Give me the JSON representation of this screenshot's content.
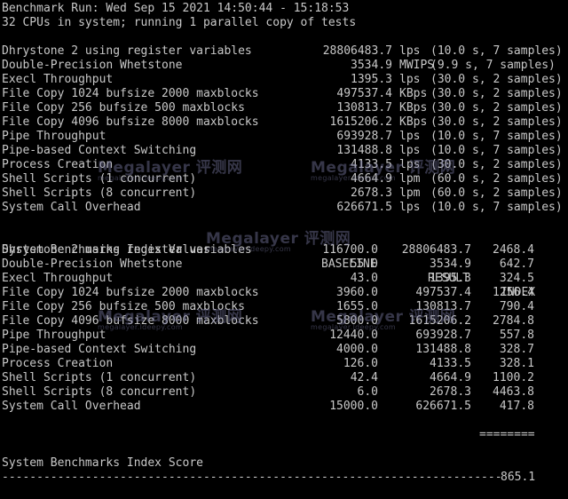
{
  "header": {
    "run_line": "Benchmark Run: Wed Sep 15 2021 14:50:44 - 15:18:53",
    "cpu_line": "32 CPUs in system; running 1 parallel copy of tests"
  },
  "results": [
    {
      "name": "Dhrystone 2 using register variables",
      "value": "28806483.7",
      "unit": "lps",
      "detail": "(10.0 s, 7 samples)"
    },
    {
      "name": "Double-Precision Whetstone",
      "value": "3534.9",
      "unit": "MWIPS",
      "detail": "(9.9 s, 7 samples)"
    },
    {
      "name": "Execl Throughput",
      "value": "1395.3",
      "unit": "lps",
      "detail": "(30.0 s, 2 samples)"
    },
    {
      "name": "File Copy 1024 bufsize 2000 maxblocks",
      "value": "497537.4",
      "unit": "KBps",
      "detail": "(30.0 s, 2 samples)"
    },
    {
      "name": "File Copy 256 bufsize 500 maxblocks",
      "value": "130813.7",
      "unit": "KBps",
      "detail": "(30.0 s, 2 samples)"
    },
    {
      "name": "File Copy 4096 bufsize 8000 maxblocks",
      "value": "1615206.2",
      "unit": "KBps",
      "detail": "(30.0 s, 2 samples)"
    },
    {
      "name": "Pipe Throughput",
      "value": "693928.7",
      "unit": "lps",
      "detail": "(10.0 s, 7 samples)"
    },
    {
      "name": "Pipe-based Context Switching",
      "value": "131488.8",
      "unit": "lps",
      "detail": "(10.0 s, 7 samples)"
    },
    {
      "name": "Process Creation",
      "value": "4133.5",
      "unit": "lps",
      "detail": "(30.0 s, 2 samples)"
    },
    {
      "name": "Shell Scripts (1 concurrent)",
      "value": "4664.9",
      "unit": "lpm",
      "detail": "(60.0 s, 2 samples)"
    },
    {
      "name": "Shell Scripts (8 concurrent)",
      "value": "2678.3",
      "unit": "lpm",
      "detail": "(60.0 s, 2 samples)"
    },
    {
      "name": "System Call Overhead",
      "value": "626671.5",
      "unit": "lps",
      "detail": "(10.0 s, 7 samples)"
    }
  ],
  "index_table": {
    "title": "System Benchmarks Index Values",
    "col_baseline": "BASELINE",
    "col_result": "RESULT",
    "col_index": "INDEX",
    "rows": [
      {
        "name": "Dhrystone 2 using register variables",
        "baseline": "116700.0",
        "result": "28806483.7",
        "index": "2468.4"
      },
      {
        "name": "Double-Precision Whetstone",
        "baseline": "55.0",
        "result": "3534.9",
        "index": "642.7"
      },
      {
        "name": "Execl Throughput",
        "baseline": "43.0",
        "result": "1395.3",
        "index": "324.5"
      },
      {
        "name": "File Copy 1024 bufsize 2000 maxblocks",
        "baseline": "3960.0",
        "result": "497537.4",
        "index": "1256.4"
      },
      {
        "name": "File Copy 256 bufsize 500 maxblocks",
        "baseline": "1655.0",
        "result": "130813.7",
        "index": "790.4"
      },
      {
        "name": "File Copy 4096 bufsize 8000 maxblocks",
        "baseline": "5800.0",
        "result": "1615206.2",
        "index": "2784.8"
      },
      {
        "name": "Pipe Throughput",
        "baseline": "12440.0",
        "result": "693928.7",
        "index": "557.8"
      },
      {
        "name": "Pipe-based Context Switching",
        "baseline": "4000.0",
        "result": "131488.8",
        "index": "328.7"
      },
      {
        "name": "Process Creation",
        "baseline": "126.0",
        "result": "4133.5",
        "index": "328.1"
      },
      {
        "name": "Shell Scripts (1 concurrent)",
        "baseline": "42.4",
        "result": "4664.9",
        "index": "1100.2"
      },
      {
        "name": "Shell Scripts (8 concurrent)",
        "baseline": "6.0",
        "result": "2678.3",
        "index": "4463.8"
      },
      {
        "name": "System Call Overhead",
        "baseline": "15000.0",
        "result": "626671.5",
        "index": "417.8"
      }
    ],
    "separator": "========",
    "score_label": "System Benchmarks Index Score",
    "score_value": "865.1"
  },
  "footer_rule": "------------------------------------------------------------------------",
  "watermark": {
    "brand": "Megalayer 评测网",
    "url": "megalayer.ldeepy.com"
  },
  "colors": {
    "background": "#000000",
    "text": "#c8c8c8"
  }
}
